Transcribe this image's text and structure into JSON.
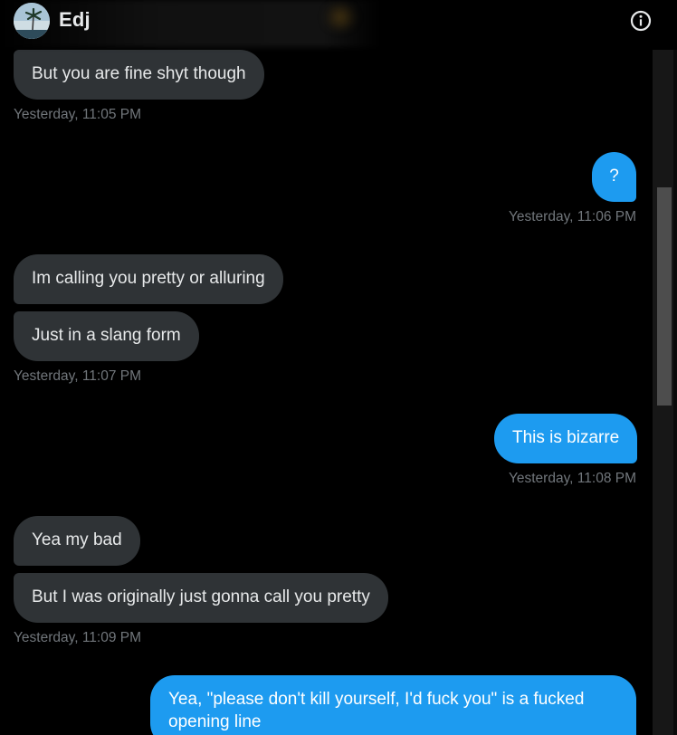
{
  "header": {
    "contact_name": "Edj",
    "info_icon": "info-circle-icon"
  },
  "messages": [
    {
      "id": "m1",
      "side": "in",
      "text": "But you are fine shyt though"
    },
    {
      "id": "t1",
      "type": "timestamp",
      "side": "in",
      "text": "Yesterday, 11:05 PM"
    },
    {
      "id": "m2",
      "side": "out",
      "text": "?"
    },
    {
      "id": "t2",
      "type": "timestamp",
      "side": "out",
      "text": "Yesterday, 11:06 PM"
    },
    {
      "id": "m3",
      "side": "in",
      "text": "Im calling you pretty or alluring"
    },
    {
      "id": "m4",
      "side": "in",
      "text": "Just in a slang form"
    },
    {
      "id": "t3",
      "type": "timestamp",
      "side": "in",
      "text": "Yesterday, 11:07 PM"
    },
    {
      "id": "m5",
      "side": "out",
      "text": "This is bizarre"
    },
    {
      "id": "t4",
      "type": "timestamp",
      "side": "out",
      "text": "Yesterday, 11:08 PM"
    },
    {
      "id": "m6",
      "side": "in",
      "text": "Yea my bad"
    },
    {
      "id": "m7",
      "side": "in",
      "text": "But I was originally just gonna call you pretty"
    },
    {
      "id": "t5",
      "type": "timestamp",
      "side": "in",
      "text": "Yesterday, 11:09 PM"
    },
    {
      "id": "m8",
      "side": "out",
      "text": "Yea, \"please don't kill yourself, I'd fuck you\" is a fucked opening line"
    }
  ],
  "colors": {
    "background": "#000000",
    "incoming_bubble": "#2f3336",
    "outgoing_bubble": "#1d9bf0",
    "timestamp": "#71767b",
    "text": "#e7e9ea"
  }
}
